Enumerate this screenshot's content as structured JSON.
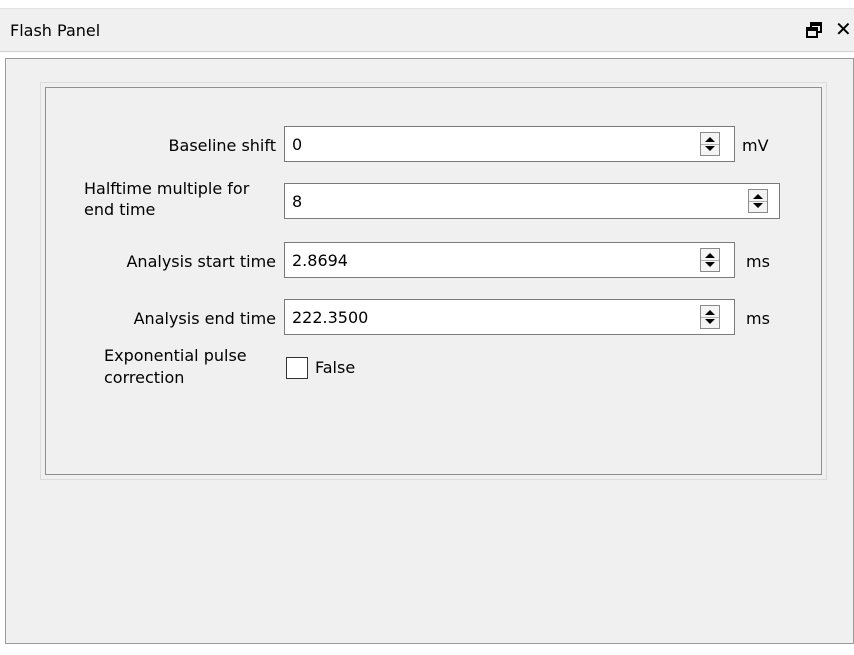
{
  "panel": {
    "title": "Flash Panel",
    "float_icon": "float-restore-icon",
    "close_label": "✕"
  },
  "form": {
    "baseline_shift": {
      "label": "Baseline shift",
      "value": "0",
      "unit": "mV"
    },
    "halftime_multiple": {
      "label_line1": "Halftime multiple for",
      "label_line2": "end time",
      "value": "8"
    },
    "analysis_start_time": {
      "label": "Analysis start time",
      "value": "2.8694",
      "unit": "ms"
    },
    "analysis_end_time": {
      "label": "Analysis end time",
      "value": "222.3500",
      "unit": "ms"
    },
    "exponential_pulse_correction": {
      "label_line1": "Exponential pulse",
      "label_line2": "correction",
      "checked": false,
      "state_text": "False"
    }
  }
}
